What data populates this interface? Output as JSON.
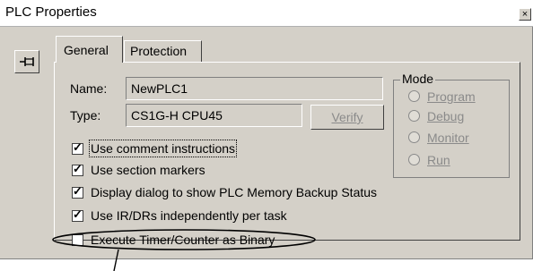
{
  "window": {
    "title": "PLC Properties",
    "close_glyph": "×"
  },
  "tabs": [
    {
      "label": "General",
      "selected": true
    },
    {
      "label": "Protection",
      "selected": false
    }
  ],
  "fields": {
    "name_label": "Name:",
    "name_value": "NewPLC1",
    "type_label": "Type:",
    "type_value": "CS1G-H  CPU45"
  },
  "verify_button": "Verify",
  "mode": {
    "legend": "Mode",
    "options": [
      "Program",
      "Debug",
      "Monitor",
      "Run"
    ]
  },
  "checkboxes": [
    {
      "label": "Use comment instructions",
      "checked": true
    },
    {
      "label": "Use section markers",
      "checked": true
    },
    {
      "label": "Display dialog to show PLC Memory Backup Status",
      "checked": true
    },
    {
      "label": "Use IR/DRs independently per task",
      "checked": true
    },
    {
      "label": "Execute Timer/Counter as Binary",
      "checked": false
    }
  ],
  "check_glyph": "✓",
  "icons": {
    "pin": "pin-icon",
    "close": "close-icon"
  }
}
